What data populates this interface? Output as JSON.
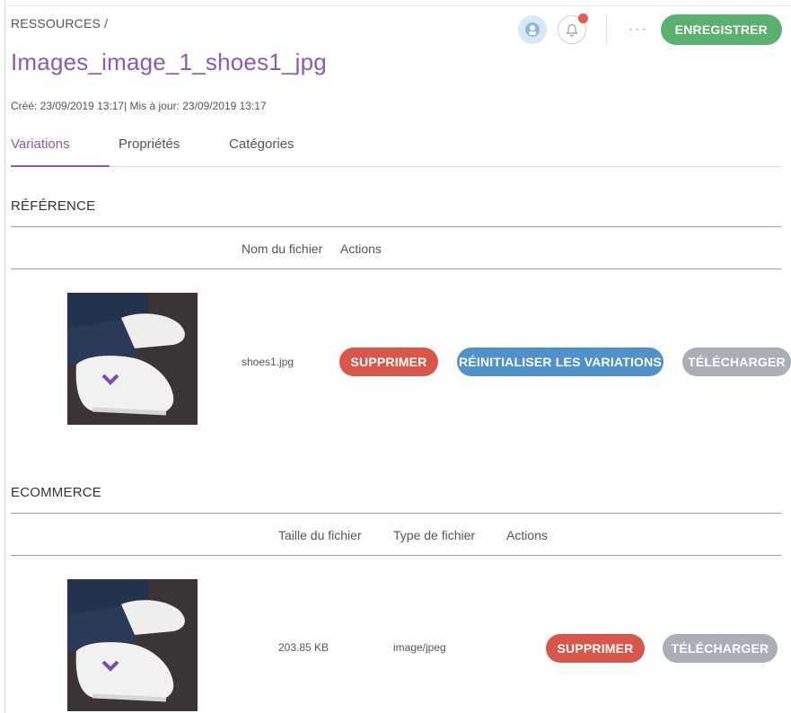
{
  "header": {
    "breadcrumb": "RESSOURCES /",
    "title": "Images_image_1_shoes1_jpg",
    "meta": "Créé: 23/09/2019 13:17| Mis à jour: 23/09/2019 13:17",
    "more_label": "···",
    "save_label": "ENREGISTRER"
  },
  "tabs": [
    {
      "label": "Variations",
      "active": true
    },
    {
      "label": "Propriétés",
      "active": false
    },
    {
      "label": "Catégories",
      "active": false
    }
  ],
  "reference": {
    "title": "RÉFÉRENCE",
    "columns": {
      "filename": "Nom du fichier",
      "actions": "Actions"
    },
    "row": {
      "filename": "shoes1.jpg",
      "delete_label": "SUPPRIMER",
      "reset_label": "RÉINITIALISER LES VARIATIONS",
      "download_label": "TÉLÉCHARGER"
    }
  },
  "ecommerce": {
    "title": "ECOMMERCE",
    "columns": {
      "size": "Taille du fichier",
      "type": "Type de fichier",
      "actions": "Actions"
    },
    "row": {
      "size": "203.85 KB",
      "type": "image/jpeg",
      "delete_label": "SUPPRIMER",
      "download_label": "TÉLÉCHARGER"
    }
  },
  "colors": {
    "accent": "#8e59b6",
    "save": "#5ab16f",
    "delete": "#d9574a",
    "reset": "#4f91c9",
    "download": "#a9afb6",
    "notification": "#e55a4f"
  },
  "icons": [
    "avatar-icon",
    "bell-icon",
    "more-icon"
  ]
}
